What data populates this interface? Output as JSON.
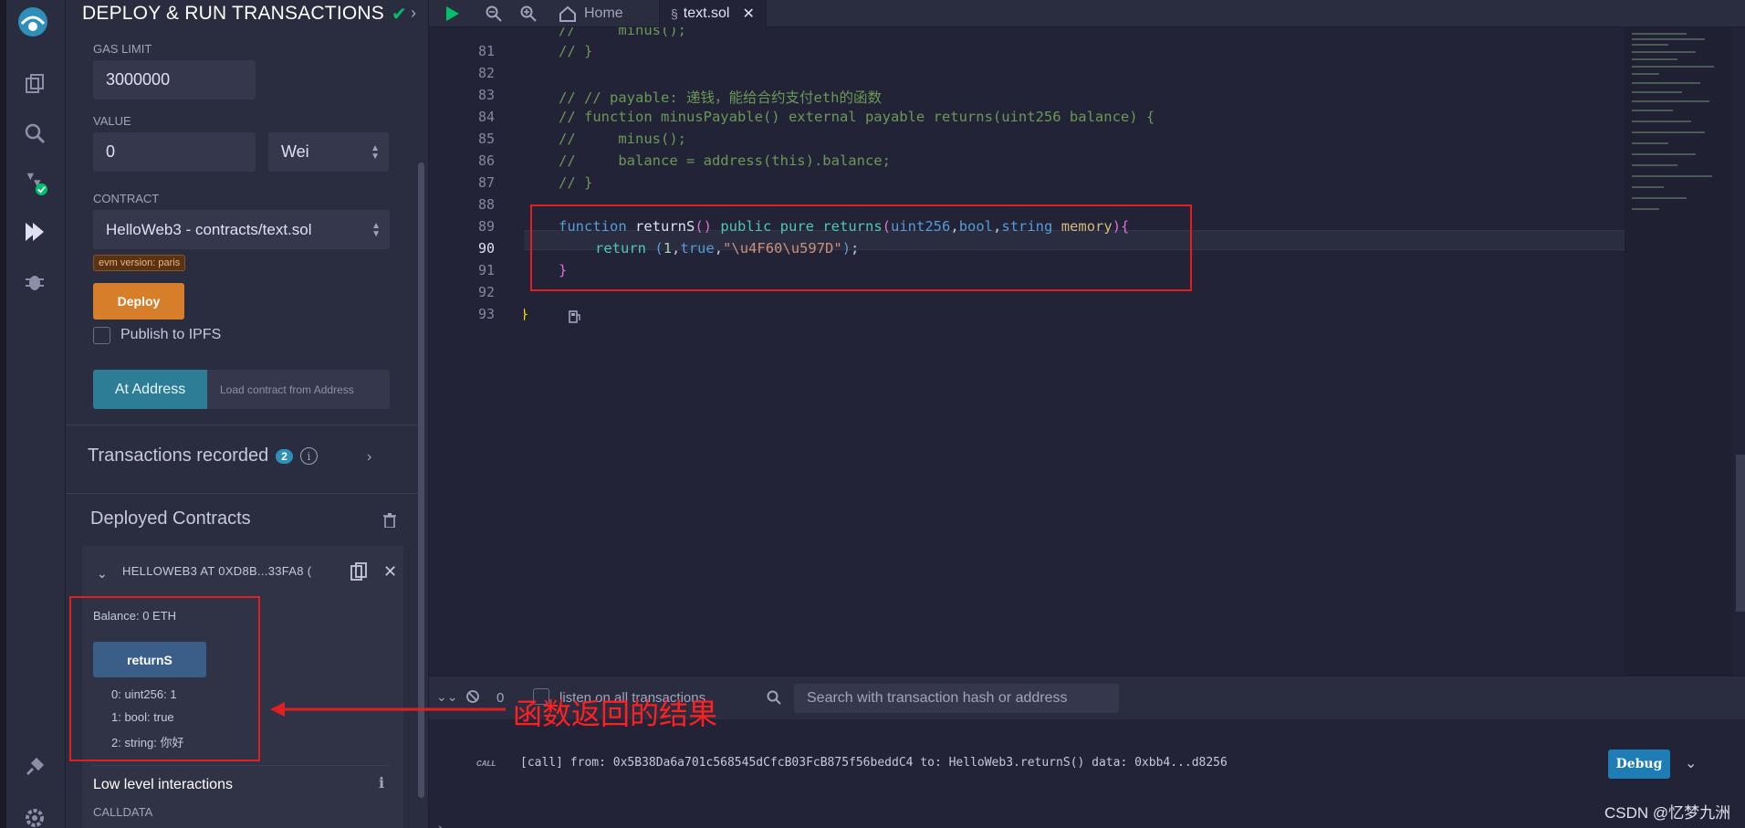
{
  "panel": {
    "title": "DEPLOY & RUN TRANSACTIONS",
    "gas_limit_label": "GAS LIMIT",
    "gas_limit_value": "3000000",
    "value_label": "VALUE",
    "value_amount": "0",
    "value_unit": "Wei",
    "contract_label": "CONTRACT",
    "contract_selected": "HelloWeb3 - contracts/text.sol",
    "evm_badge": "evm version: paris",
    "deploy_label": "Deploy",
    "publish_label": "Publish to IPFS",
    "at_address_label": "At Address",
    "load_placeholder": "Load contract from Address",
    "transactions_recorded": "Transactions recorded",
    "transactions_count": "2",
    "deployed_contracts": "Deployed Contracts",
    "contract_instance": "HELLOWEB3 AT 0XD8B...33FA8 (",
    "balance": "Balance: 0 ETH",
    "function_button": "returnS",
    "returns": [
      "0: uint256: 1",
      "1: bool: true",
      "2: string: 你好"
    ],
    "low_level_title": "Low level interactions",
    "calldata_label": "CALLDATA"
  },
  "tabs": {
    "home": "Home",
    "file": "text.sol"
  },
  "editor": {
    "active_line": 90,
    "line_numbers": [
      "81",
      "82",
      "83",
      "84",
      "85",
      "86",
      "87",
      "88",
      "89",
      "90",
      "91",
      "92",
      "93"
    ]
  },
  "terminal": {
    "count": "0",
    "listen_label": "listen on all transactions",
    "search_placeholder": "Search with transaction hash or address",
    "call_tag": "CALL",
    "call_log": "[call] from: 0x5B38Da6a701c568545dCfcB03FcB875f56beddC4 to: HelloWeb3.returnS() data: 0xbb4...d8256",
    "debug_label": "Debug"
  },
  "annotation": {
    "text": "函数返回的结果",
    "color": "#ff2020"
  },
  "watermark": "CSDN @忆梦九洲",
  "icons": [
    "remix-logo-icon",
    "file-explorer-icon",
    "search-icon",
    "solidity-compiler-icon",
    "deploy-icon",
    "debugger-icon",
    "plugin-icon",
    "settings-icon",
    "run-icon",
    "zoom-out-icon",
    "zoom-in-icon",
    "home-icon",
    "close-icon",
    "trash-icon",
    "copy-icon",
    "info-icon"
  ],
  "colors": {
    "accent": "#d67e2a",
    "primary": "#2e7d97",
    "success": "#00c16b",
    "annotation": "#e02020"
  }
}
